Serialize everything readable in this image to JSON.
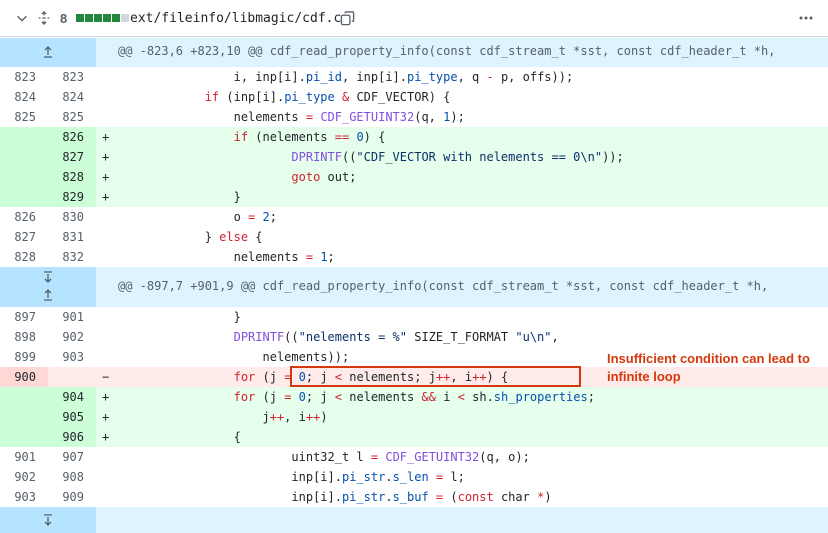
{
  "file_header": {
    "changes_count": "8",
    "diffstat": [
      "#1f883d",
      "#1f883d",
      "#1f883d",
      "#1f883d",
      "#1f883d",
      "#d0d7de"
    ],
    "path": "ext/fileinfo/libmagic/cdf.c",
    "icons": [
      "chevron-down-icon",
      "unfold-icon",
      "copy-icon",
      "kebab-horizontal-icon"
    ]
  },
  "hunks": [
    {
      "text": "@@ -823,6 +823,10 @@ cdf_read_property_info(const cdf_stream_t *sst, const cdf_header_t *h,"
    },
    {
      "text": "@@ -897,7 +901,9 @@ cdf_read_property_info(const cdf_stream_t *sst, const cdf_header_t *h,"
    }
  ],
  "lines": [
    {
      "old": "823",
      "new": "823",
      "mark": "",
      "type": "ctx",
      "code": "                i, inp[i].pi_id, inp[i].pi_type, q - p, offs));"
    },
    {
      "old": "824",
      "new": "824",
      "mark": "",
      "type": "ctx",
      "code": "            if (inp[i].pi_type & CDF_VECTOR) {"
    },
    {
      "old": "825",
      "new": "825",
      "mark": "",
      "type": "ctx",
      "code": "                nelements = CDF_GETUINT32(q, 1);"
    },
    {
      "old": "",
      "new": "826",
      "mark": "+",
      "type": "add",
      "code": "                if (nelements == 0) {"
    },
    {
      "old": "",
      "new": "827",
      "mark": "+",
      "type": "add",
      "code": "                        DPRINTF((\"CDF_VECTOR with nelements == 0\\n\"));"
    },
    {
      "old": "",
      "new": "828",
      "mark": "+",
      "type": "add",
      "code": "                        goto out;"
    },
    {
      "old": "",
      "new": "829",
      "mark": "+",
      "type": "add",
      "code": "                }"
    },
    {
      "old": "826",
      "new": "830",
      "mark": "",
      "type": "ctx",
      "code": "                o = 2;"
    },
    {
      "old": "827",
      "new": "831",
      "mark": "",
      "type": "ctx",
      "code": "            } else {"
    },
    {
      "old": "828",
      "new": "832",
      "mark": "",
      "type": "ctx",
      "code": "                nelements = 1;"
    },
    {
      "old": "897",
      "new": "901",
      "mark": "",
      "type": "ctx",
      "code": "                }"
    },
    {
      "old": "898",
      "new": "902",
      "mark": "",
      "type": "ctx",
      "code": "                DPRINTF((\"nelements = %\" SIZE_T_FORMAT \"u\\n\","
    },
    {
      "old": "899",
      "new": "903",
      "mark": "",
      "type": "ctx",
      "code": "                    nelements));"
    },
    {
      "old": "900",
      "new": "",
      "mark": "-",
      "type": "del",
      "code": "                for (j = 0; j < nelements; j++, i++) {"
    },
    {
      "old": "",
      "new": "904",
      "mark": "+",
      "type": "add",
      "code": "                for (j = 0; j < nelements && i < sh.sh_properties;"
    },
    {
      "old": "",
      "new": "905",
      "mark": "+",
      "type": "add",
      "code": "                    j++, i++)"
    },
    {
      "old": "",
      "new": "906",
      "mark": "+",
      "type": "add",
      "code": "                {"
    },
    {
      "old": "901",
      "new": "907",
      "mark": "",
      "type": "ctx",
      "code": "                        uint32_t l = CDF_GETUINT32(q, o);"
    },
    {
      "old": "902",
      "new": "908",
      "mark": "",
      "type": "ctx",
      "code": "                        inp[i].pi_str.s_len = l;"
    },
    {
      "old": "903",
      "new": "909",
      "mark": "",
      "type": "ctx",
      "code": "                        inp[i].pi_str.s_buf = (const char *)"
    }
  ],
  "annotation": {
    "text": "Insufficient condition can lead to infinite loop",
    "color": "#d4380d"
  }
}
